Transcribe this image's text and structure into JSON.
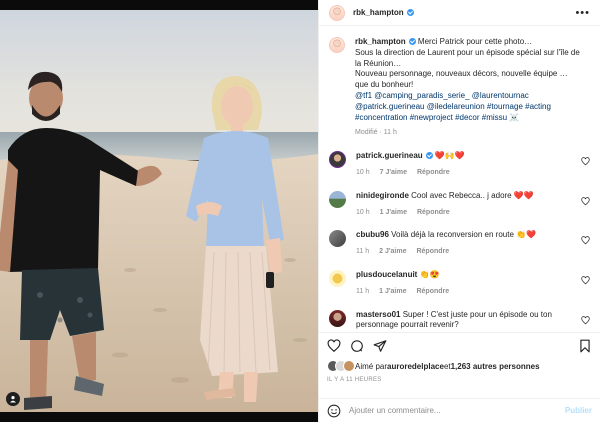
{
  "post": {
    "image_alt": "",
    "owner": {
      "username": "rbk_hampton",
      "verified": true
    },
    "caption": {
      "username": "rbk_hampton",
      "lines": [
        "Merci Patrick pour cette photo…",
        "Sous la direction de Laurent pour un épisode spécial sur l'île de la Réunion…",
        "Nouveau personnage, nouveaux décors, nouvelle équipe … que du bonheur!"
      ],
      "mentions": "@tf1 @camping_paradis_serie_ @laurentournac @patrick.guerineau @iledelareunion #tournage #acting #concentration #newproject #decor #missu ☠️",
      "meta": "Modifié · 11 h"
    },
    "comments": [
      {
        "username": "patrick.guerineau",
        "verified": true,
        "text": "❤️🙌❤️",
        "time": "10 h",
        "likes": "7 J'aime",
        "reply": "Répondre",
        "avatar": "av1"
      },
      {
        "username": "ninidegironde",
        "verified": false,
        "text": "Cool avec Rebecca.. j adore ❤️❤️",
        "time": "10 h",
        "likes": "1 J'aime",
        "reply": "Répondre",
        "avatar": "av2"
      },
      {
        "username": "cbubu96",
        "verified": false,
        "text": "Voilà déjà la reconversion en route 👏❤️",
        "time": "11 h",
        "likes": "2 J'aime",
        "reply": "Répondre",
        "avatar": "av3"
      },
      {
        "username": "plusdoucelanuit",
        "verified": false,
        "text": "👏😍",
        "time": "11 h",
        "likes": "1 J'aime",
        "reply": "Répondre",
        "avatar": "av4"
      },
      {
        "username": "masterso01",
        "verified": false,
        "text": "Super ! C'est juste pour un épisode ou ton personnage pourrait revenir?",
        "time": "11 h",
        "likes": "1 J'aime",
        "reply": "Répondre",
        "avatar": "av5"
      }
    ],
    "likes": {
      "prefix": "Aimé par ",
      "user": "auroredelplace",
      "suffix_pre": " et ",
      "count": "1,263 autres personnes"
    },
    "time_ago": "IL Y A 11 HEURES",
    "composer": {
      "placeholder": "Ajouter un commentaire...",
      "publish": "Publier"
    }
  },
  "icons": {
    "more": "more-horizontal-icon",
    "like": "heart-icon",
    "comment": "comment-bubble-icon",
    "share": "paper-plane-icon",
    "save": "bookmark-icon",
    "emoji": "smiley-icon",
    "tag": "user-tag-icon"
  },
  "colors": {
    "link": "#00376b",
    "verified": "#3897f0",
    "publish_disabled": "#b2dffc",
    "muted": "#8e8e8e"
  }
}
